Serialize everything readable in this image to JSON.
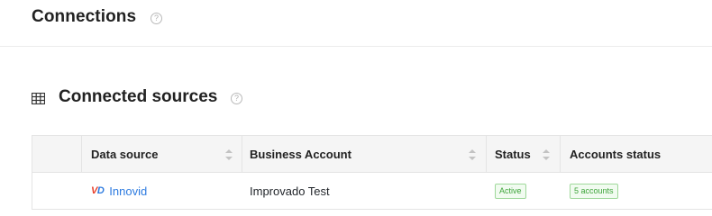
{
  "header": {
    "title": "Connections",
    "help_glyph": "?"
  },
  "section": {
    "title": "Connected sources",
    "icon": "table-grid-icon",
    "help_glyph": "?"
  },
  "table": {
    "columns": {
      "data_source": "Data source",
      "business_account": "Business Account",
      "status": "Status",
      "accounts_status": "Accounts status"
    },
    "rows": [
      {
        "logo_text_v": "V",
        "logo_text_d": "D",
        "data_source": "Innovid",
        "business_account": "Improvado Test",
        "status": "Active",
        "accounts_status": "5 accounts"
      }
    ]
  },
  "colors": {
    "link": "#2d7be0",
    "badge_green": "#3ea43a",
    "logo_red": "#e8412c"
  }
}
